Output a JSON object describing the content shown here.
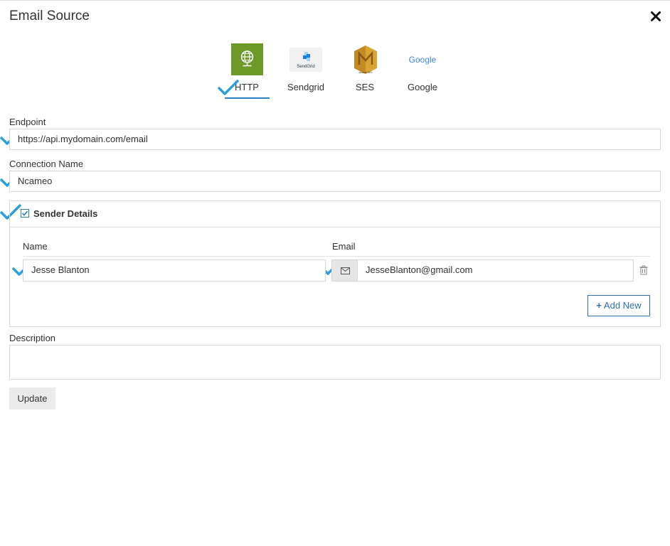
{
  "dialog": {
    "title": "Email Source"
  },
  "providers": [
    {
      "label": "HTTP",
      "selected": true,
      "icon": "globe-icon"
    },
    {
      "label": "Sendgrid",
      "selected": false,
      "icon": "sendgrid-logo",
      "logo_text": "SendGrid"
    },
    {
      "label": "SES",
      "selected": false,
      "icon": "aws-ses-logo",
      "logo_text": "Amazon SES"
    },
    {
      "label": "Google",
      "selected": false,
      "icon": "google-logo",
      "logo_text": "Google"
    }
  ],
  "form": {
    "endpoint": {
      "label": "Endpoint",
      "value": "https://api.mydomain.com/email"
    },
    "connection_name": {
      "label": "Connection Name",
      "value": "Ncameo"
    },
    "sender_details": {
      "title": "Sender Details",
      "checked": true,
      "columns": {
        "name": "Name",
        "email": "Email"
      },
      "rows": [
        {
          "name": "Jesse Blanton",
          "email": "JesseBlanton@gmail.com"
        }
      ],
      "add_label": "Add New"
    },
    "description": {
      "label": "Description",
      "value": ""
    },
    "update_label": "Update"
  },
  "colors": {
    "accent": "#2f7fc1",
    "check": "#2a9fd8",
    "http_tile": "#6e9a29"
  }
}
